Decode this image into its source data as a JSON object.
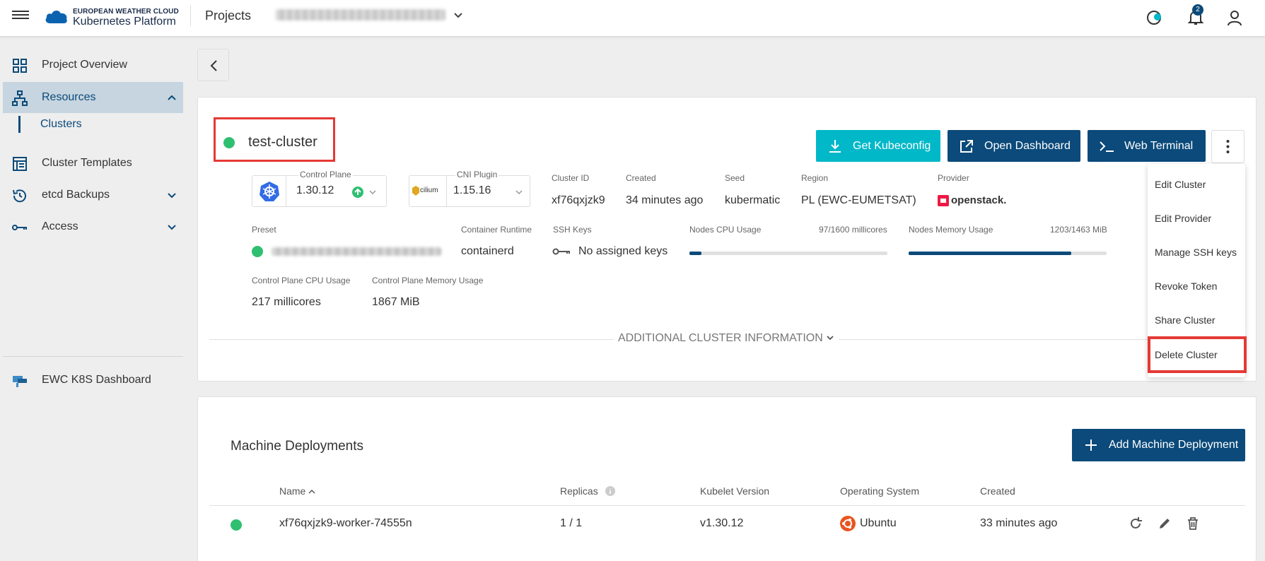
{
  "header": {
    "logo_line1": "EUROPEAN WEATHER CLOUD",
    "logo_line2": "Kubernetes Platform",
    "projects_label": "Projects",
    "notification_count": "2"
  },
  "sidebar": {
    "items": [
      {
        "label": "Project Overview",
        "icon": "grid-icon"
      },
      {
        "label": "Resources",
        "icon": "sitemap-icon",
        "active": true
      },
      {
        "label": "Clusters",
        "sub": true
      },
      {
        "label": "Cluster Templates",
        "icon": "template-icon"
      },
      {
        "label": "etcd Backups",
        "icon": "history-icon"
      },
      {
        "label": "Access",
        "icon": "key-icon"
      },
      {
        "label": "EWC K8S Dashboard",
        "icon": "dashboard-icon"
      }
    ]
  },
  "cluster": {
    "name": "test-cluster",
    "status_color": "#2fbf71",
    "buttons": {
      "kubeconfig": "Get Kubeconfig",
      "dashboard": "Open Dashboard",
      "terminal": "Web Terminal"
    },
    "control_plane": {
      "label": "Control Plane",
      "value": "1.30.12"
    },
    "cni_plugin": {
      "label": "CNI Plugin",
      "value": "1.15.16",
      "logo_text": "cilium"
    },
    "cluster_id": {
      "label": "Cluster ID",
      "value": "xf76qxjzk9"
    },
    "created": {
      "label": "Created",
      "value": "34 minutes ago"
    },
    "seed": {
      "label": "Seed",
      "value": "kubermatic"
    },
    "region": {
      "label": "Region",
      "value": "PL (EWC-EUMETSAT)"
    },
    "provider": {
      "label": "Provider",
      "value": "openstack."
    },
    "preset": {
      "label": "Preset"
    },
    "container_runtime": {
      "label": "Container Runtime",
      "value": "containerd"
    },
    "ssh_keys": {
      "label": "SSH Keys",
      "value": "No assigned keys"
    },
    "nodes_cpu": {
      "label": "Nodes CPU Usage",
      "value": "97/1600 millicores",
      "fraction": 0.061
    },
    "nodes_memory": {
      "label": "Nodes Memory Usage",
      "value": "1203/1463 MiB",
      "fraction": 0.822
    },
    "cp_cpu": {
      "label": "Control Plane CPU Usage",
      "value": "217 millicores"
    },
    "cp_memory": {
      "label": "Control Plane Memory Usage",
      "value": "1867 MiB"
    },
    "additional_info": "ADDITIONAL CLUSTER INFORMATION"
  },
  "menu": {
    "items": [
      "Edit Cluster",
      "Edit Provider",
      "Manage SSH keys",
      "Revoke Token",
      "Share Cluster",
      "Delete Cluster"
    ]
  },
  "machine_deployments": {
    "title": "Machine Deployments",
    "add_button": "Add Machine Deployment",
    "columns": [
      "Name",
      "Replicas",
      "Kubelet Version",
      "Operating System",
      "Created"
    ],
    "rows": [
      {
        "name": "xf76qxjzk9-worker-74555n",
        "replicas": "1 / 1",
        "kubelet": "v1.30.12",
        "os": "Ubuntu",
        "created": "33 minutes ago"
      }
    ]
  },
  "colors": {
    "accent": "#0b4a7a",
    "teal": "#00b8c8",
    "highlight": "#e53935",
    "status_ok": "#2fbf71"
  }
}
